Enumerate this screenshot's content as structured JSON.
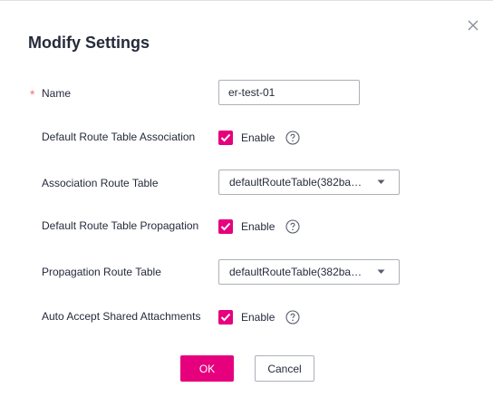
{
  "dialog": {
    "title": "Modify Settings",
    "close_icon": "close-icon"
  },
  "form": {
    "name": {
      "required_mark": "*",
      "label": "Name",
      "value": "er-test-01"
    },
    "default_association": {
      "label": "Default Route Table Association",
      "checked": true,
      "option_label": "Enable",
      "help_icon": "question-circle-icon"
    },
    "association_table": {
      "label": "Association Route Table",
      "selected": "defaultRouteTable(382ba…",
      "caret_icon": "caret-down-icon"
    },
    "default_propagation": {
      "label": "Default Route Table Propagation",
      "checked": true,
      "option_label": "Enable",
      "help_icon": "question-circle-icon"
    },
    "propagation_table": {
      "label": "Propagation Route Table",
      "selected": "defaultRouteTable(382ba…",
      "caret_icon": "caret-down-icon"
    },
    "auto_accept": {
      "label": "Auto Accept Shared Attachments",
      "checked": true,
      "option_label": "Enable",
      "help_icon": "question-circle-icon"
    }
  },
  "actions": {
    "ok_label": "OK",
    "cancel_label": "Cancel"
  },
  "colors": {
    "primary": "#e6007e",
    "required": "#f66f6a",
    "text": "#252b3a",
    "border": "#adb0b8"
  }
}
